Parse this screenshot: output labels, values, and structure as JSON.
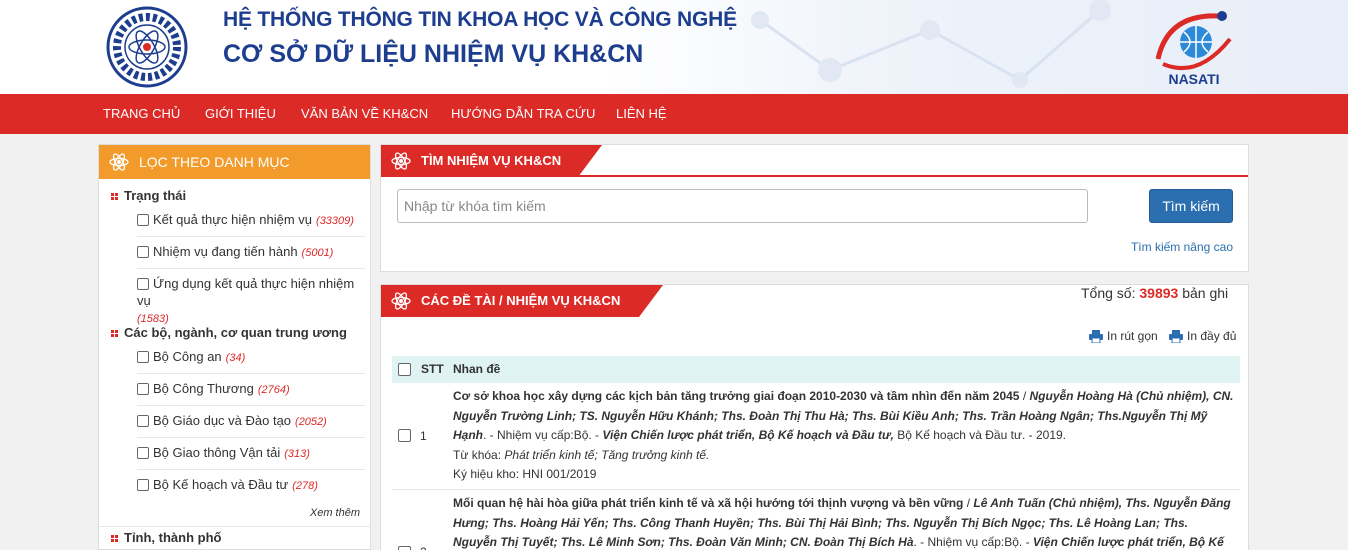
{
  "header": {
    "title1": "HỆ THỐNG THÔNG TIN KHOA HỌC VÀ CÔNG NGHỆ",
    "title2": "CƠ SỞ DỮ LIỆU NHIỆM VỤ KH&CN",
    "logo_right_text": "NASATI",
    "logo_left_text": "BỘ KHOA HỌC VÀ CÔNG NGHỆ"
  },
  "nav": [
    "TRANG CHỦ",
    "GIỚI THIỆU",
    "VĂN BẢN VỀ KH&CN",
    "HƯỚNG DẪN TRA CỨU",
    "LIÊN HỆ"
  ],
  "sidebar": {
    "title": "LỌC THEO DANH MỤC",
    "group1": {
      "label": "Trạng thái",
      "items": [
        {
          "label": "Kết quả thực hiện nhiệm vụ",
          "count": "(33309)"
        },
        {
          "label": "Nhiệm vụ đang tiến hành",
          "count": "(5001)"
        },
        {
          "label": "Ứng dụng kết quả thực hiện nhiệm vụ",
          "count": "(1583)"
        }
      ]
    },
    "group2": {
      "label": "Các bộ, ngành, cơ quan trung ương",
      "items": [
        {
          "label": "Bộ Công an",
          "count": "(34)"
        },
        {
          "label": "Bộ Công Thương",
          "count": "(2764)"
        },
        {
          "label": "Bộ Giáo dục và Đào tạo",
          "count": "(2052)"
        },
        {
          "label": "Bộ Giao thông Vận tải",
          "count": "(313)"
        },
        {
          "label": "Bộ Kế hoạch và Đầu tư",
          "count": "(278)"
        }
      ]
    },
    "more": "Xem thêm",
    "group3": {
      "label": "Tỉnh, thành phố"
    }
  },
  "search": {
    "tab": "TÌM NHIỆM VỤ KH&CN",
    "placeholder": "Nhập từ khóa tìm kiếm",
    "button": "Tìm kiếm",
    "advanced": "Tìm kiếm nâng cao"
  },
  "results": {
    "tab": "CÁC ĐỀ TÀI / NHIỆM VỤ KH&CN",
    "total_label": "Tổng số:",
    "total": "39893",
    "total_unit": "bản ghi",
    "print_short": "In rút gọn",
    "print_full": "In đầy đủ",
    "col_stt": "STT",
    "col_title": "Nhan đề",
    "rows": [
      {
        "stt": "1",
        "title": "Cơ sở khoa học xây dựng các kịch bản tăng trưởng giai đoạn 2010-2030 và tầm nhìn đến năm 2045",
        "authors": "Nguyễn Hoàng Hà (Chủ nhiệm), CN. Nguyễn Trường Linh; TS. Nguyễn Hữu Khánh; Ths. Đoàn Thị Thu Hà; Ths. Bùi Kiều Anh; Ths. Trần Hoàng Ngân; Ths.Nguyễn Thị Mỹ Hạnh",
        "level": "Nhiệm vụ cấp:Bộ.",
        "org": "Viện Chiến lược phát triển, Bộ Kế hoạch và Đầu tư,",
        "after": "Bộ Kế hoạch và Đầu tư. - 2019.",
        "kw_label": "Từ khóa:",
        "keywords": "Phát triển kinh tế; Tăng trưởng kinh tế.",
        "code": "Ký hiệu kho: HNI 001/2019"
      },
      {
        "stt": "2",
        "title": "Mối quan hệ hài hòa giữa phát triển kinh tế và xã hội hướng tới thịnh vượng và bền vững",
        "authors": "Lê Anh Tuấn (Chủ nhiệm), Ths. Nguyễn Đăng Hưng; Ths. Hoàng Hải Yến; Ths. Công Thanh Huyền; Ths. Bùi Thị Hải Bình; Ths. Nguyễn Thị Bích Ngọc; Ths. Lê Hoàng Lan; Ths. Nguyễn Thị Tuyết; Ths. Lê Minh Sơn; Ths. Đoàn Văn Minh; CN. Đoàn Thị Bích Hà",
        "level": "Nhiệm vụ cấp:Bộ.",
        "org": "Viện Chiến lược phát triển, Bộ Kế hoạch và"
      }
    ]
  },
  "colors": {
    "red": "#dc2a27",
    "orange": "#f29b2b",
    "blue": "#1d3d8f",
    "button": "#2c6fb0",
    "table_head": "#dff3f3"
  }
}
